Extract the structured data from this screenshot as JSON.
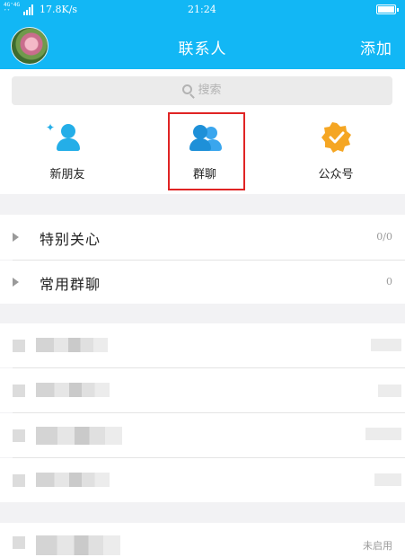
{
  "status_bar": {
    "network_line1": "4G⁺4G",
    "network_line2": "⁺⁺",
    "speed": "17.8K/s",
    "time": "21:24",
    "icons": [
      "signal-bars-icon",
      "battery-icon"
    ]
  },
  "header": {
    "title": "联系人",
    "add_label": "添加",
    "avatar_icon": "lotus-avatar"
  },
  "search": {
    "placeholder": "搜索",
    "icon": "search-icon"
  },
  "shortcuts": [
    {
      "label": "新朋友",
      "icon": "new-friend-icon",
      "color": "#24aee8"
    },
    {
      "label": "群聊",
      "icon": "group-chat-icon",
      "color": "#1e90d8",
      "highlighted": true
    },
    {
      "label": "公众号",
      "icon": "official-account-icon",
      "color": "#f5a623"
    }
  ],
  "groups": [
    {
      "name": "特别关心",
      "count": "0/0"
    },
    {
      "name": "常用群聊",
      "count": "0"
    }
  ],
  "last_row": {
    "status": "未启用"
  },
  "colors": {
    "header_bg": "#12b7f5",
    "highlight_border": "#e02424",
    "page_bg": "#f2f2f4"
  }
}
